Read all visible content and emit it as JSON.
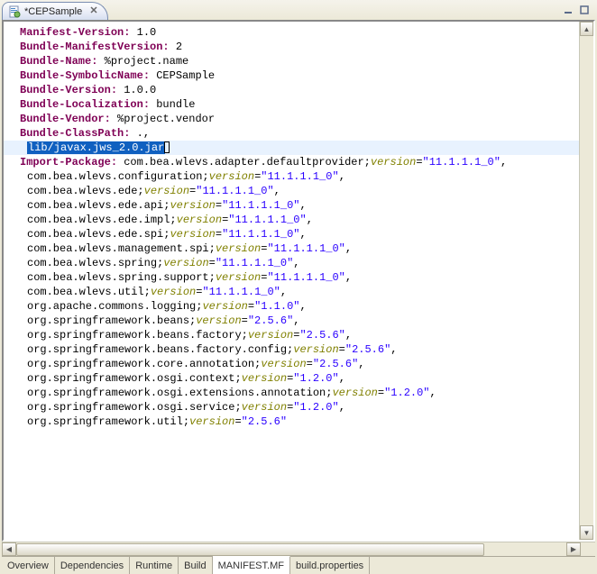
{
  "tab": {
    "title": "*CEPSample"
  },
  "bottom_tabs": [
    "Overview",
    "Dependencies",
    "Runtime",
    "Build",
    "MANIFEST.MF",
    "build.properties"
  ],
  "active_bottom_tab": "MANIFEST.MF",
  "manifest": {
    "headers": [
      {
        "k": "Manifest-Version",
        "v": "1.0"
      },
      {
        "k": "Bundle-ManifestVersion",
        "v": "2"
      },
      {
        "k": "Bundle-Name",
        "v": "%project.name"
      },
      {
        "k": "Bundle-SymbolicName",
        "v": "CEPSample"
      },
      {
        "k": "Bundle-Version",
        "v": "1.0.0"
      },
      {
        "k": "Bundle-Localization",
        "v": "bundle"
      },
      {
        "k": "Bundle-Vendor",
        "v": "%project.vendor"
      }
    ],
    "classpath_header": "Bundle-ClassPath",
    "classpath_first": ".,",
    "classpath_selected": "lib/javax.jws_2.0.jar",
    "import_header": "Import-Package",
    "import_first": {
      "pkg": "com.bea.wlevs.adapter.defaultprovider",
      "ver": "11.1.1.1_0"
    },
    "imports": [
      {
        "pkg": "com.bea.wlevs.configuration",
        "ver": "11.1.1.1_0"
      },
      {
        "pkg": "com.bea.wlevs.ede",
        "ver": "11.1.1.1_0"
      },
      {
        "pkg": "com.bea.wlevs.ede.api",
        "ver": "11.1.1.1_0"
      },
      {
        "pkg": "com.bea.wlevs.ede.impl",
        "ver": "11.1.1.1_0"
      },
      {
        "pkg": "com.bea.wlevs.ede.spi",
        "ver": "11.1.1.1_0"
      },
      {
        "pkg": "com.bea.wlevs.management.spi",
        "ver": "11.1.1.1_0"
      },
      {
        "pkg": "com.bea.wlevs.spring",
        "ver": "11.1.1.1_0"
      },
      {
        "pkg": "com.bea.wlevs.spring.support",
        "ver": "11.1.1.1_0"
      },
      {
        "pkg": "com.bea.wlevs.util",
        "ver": "11.1.1.1_0"
      },
      {
        "pkg": "org.apache.commons.logging",
        "ver": "1.1.0"
      },
      {
        "pkg": "org.springframework.beans",
        "ver": "2.5.6"
      },
      {
        "pkg": "org.springframework.beans.factory",
        "ver": "2.5.6"
      },
      {
        "pkg": "org.springframework.beans.factory.config",
        "ver": "2.5.6"
      },
      {
        "pkg": "org.springframework.core.annotation",
        "ver": "2.5.6"
      },
      {
        "pkg": "org.springframework.osgi.context",
        "ver": "1.2.0"
      },
      {
        "pkg": "org.springframework.osgi.extensions.annotation",
        "ver": "1.2.0"
      },
      {
        "pkg": "org.springframework.osgi.service",
        "ver": "1.2.0"
      },
      {
        "pkg": "org.springframework.util",
        "ver": "2.5.6"
      }
    ]
  }
}
